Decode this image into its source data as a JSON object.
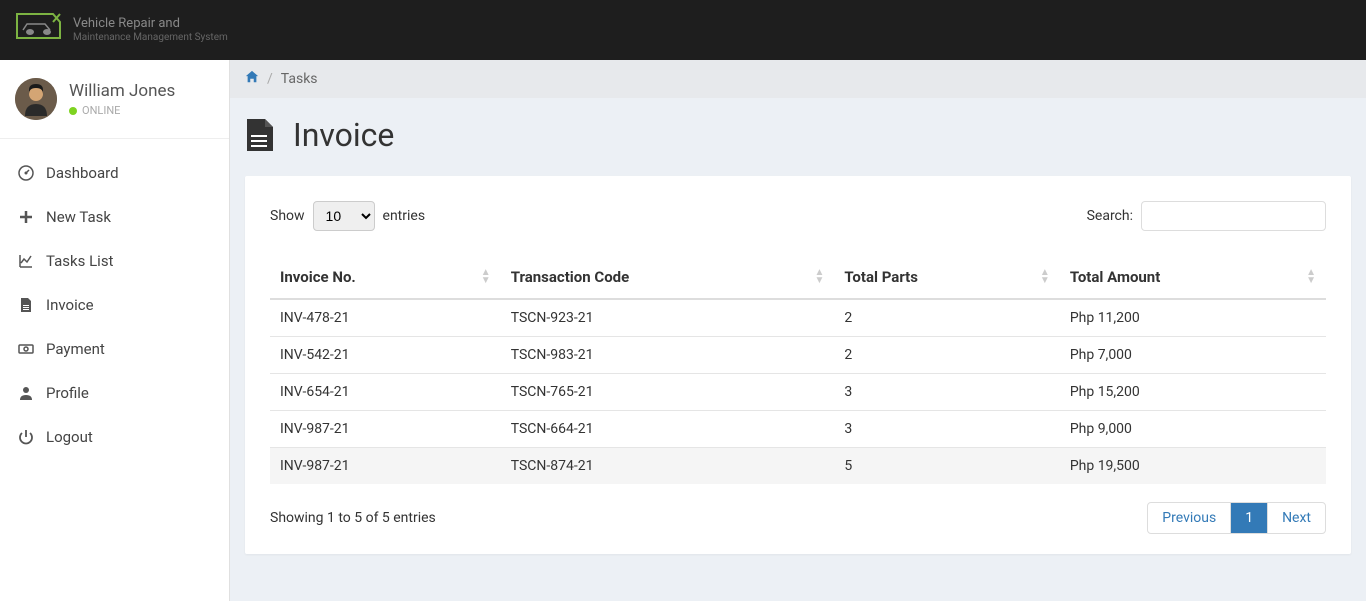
{
  "logo": {
    "line1": "Vehicle Repair and",
    "line2": "Maintenance Management System"
  },
  "user": {
    "name": "William Jones",
    "status": "ONLINE"
  },
  "nav": [
    {
      "icon": "dashboard",
      "label": "Dashboard"
    },
    {
      "icon": "plus",
      "label": "New Task"
    },
    {
      "icon": "chart",
      "label": "Tasks List"
    },
    {
      "icon": "doc",
      "label": "Invoice"
    },
    {
      "icon": "money",
      "label": "Payment"
    },
    {
      "icon": "user",
      "label": "Profile"
    },
    {
      "icon": "power",
      "label": "Logout"
    }
  ],
  "breadcrumb": {
    "home": "⌂",
    "current": "Tasks"
  },
  "page_title": "Invoice",
  "table": {
    "show_label": "Show",
    "entries_label": "entries",
    "entries_value": "10",
    "search_label": "Search:",
    "columns": [
      "Invoice No.",
      "Transaction Code",
      "Total Parts",
      "Total Amount"
    ],
    "rows": [
      {
        "invoice": "INV-478-21",
        "code": "TSCN-923-21",
        "parts": "2",
        "amount": "Php 11,200"
      },
      {
        "invoice": "INV-542-21",
        "code": "TSCN-983-21",
        "parts": "2",
        "amount": "Php 7,000"
      },
      {
        "invoice": "INV-654-21",
        "code": "TSCN-765-21",
        "parts": "3",
        "amount": "Php 15,200"
      },
      {
        "invoice": "INV-987-21",
        "code": "TSCN-664-21",
        "parts": "3",
        "amount": "Php 9,000"
      },
      {
        "invoice": "INV-987-21",
        "code": "TSCN-874-21",
        "parts": "5",
        "amount": "Php 19,500"
      }
    ],
    "info": "Showing 1 to 5 of 5 entries",
    "pagination": {
      "prev": "Previous",
      "pages": [
        "1"
      ],
      "next": "Next",
      "active": 0
    }
  }
}
